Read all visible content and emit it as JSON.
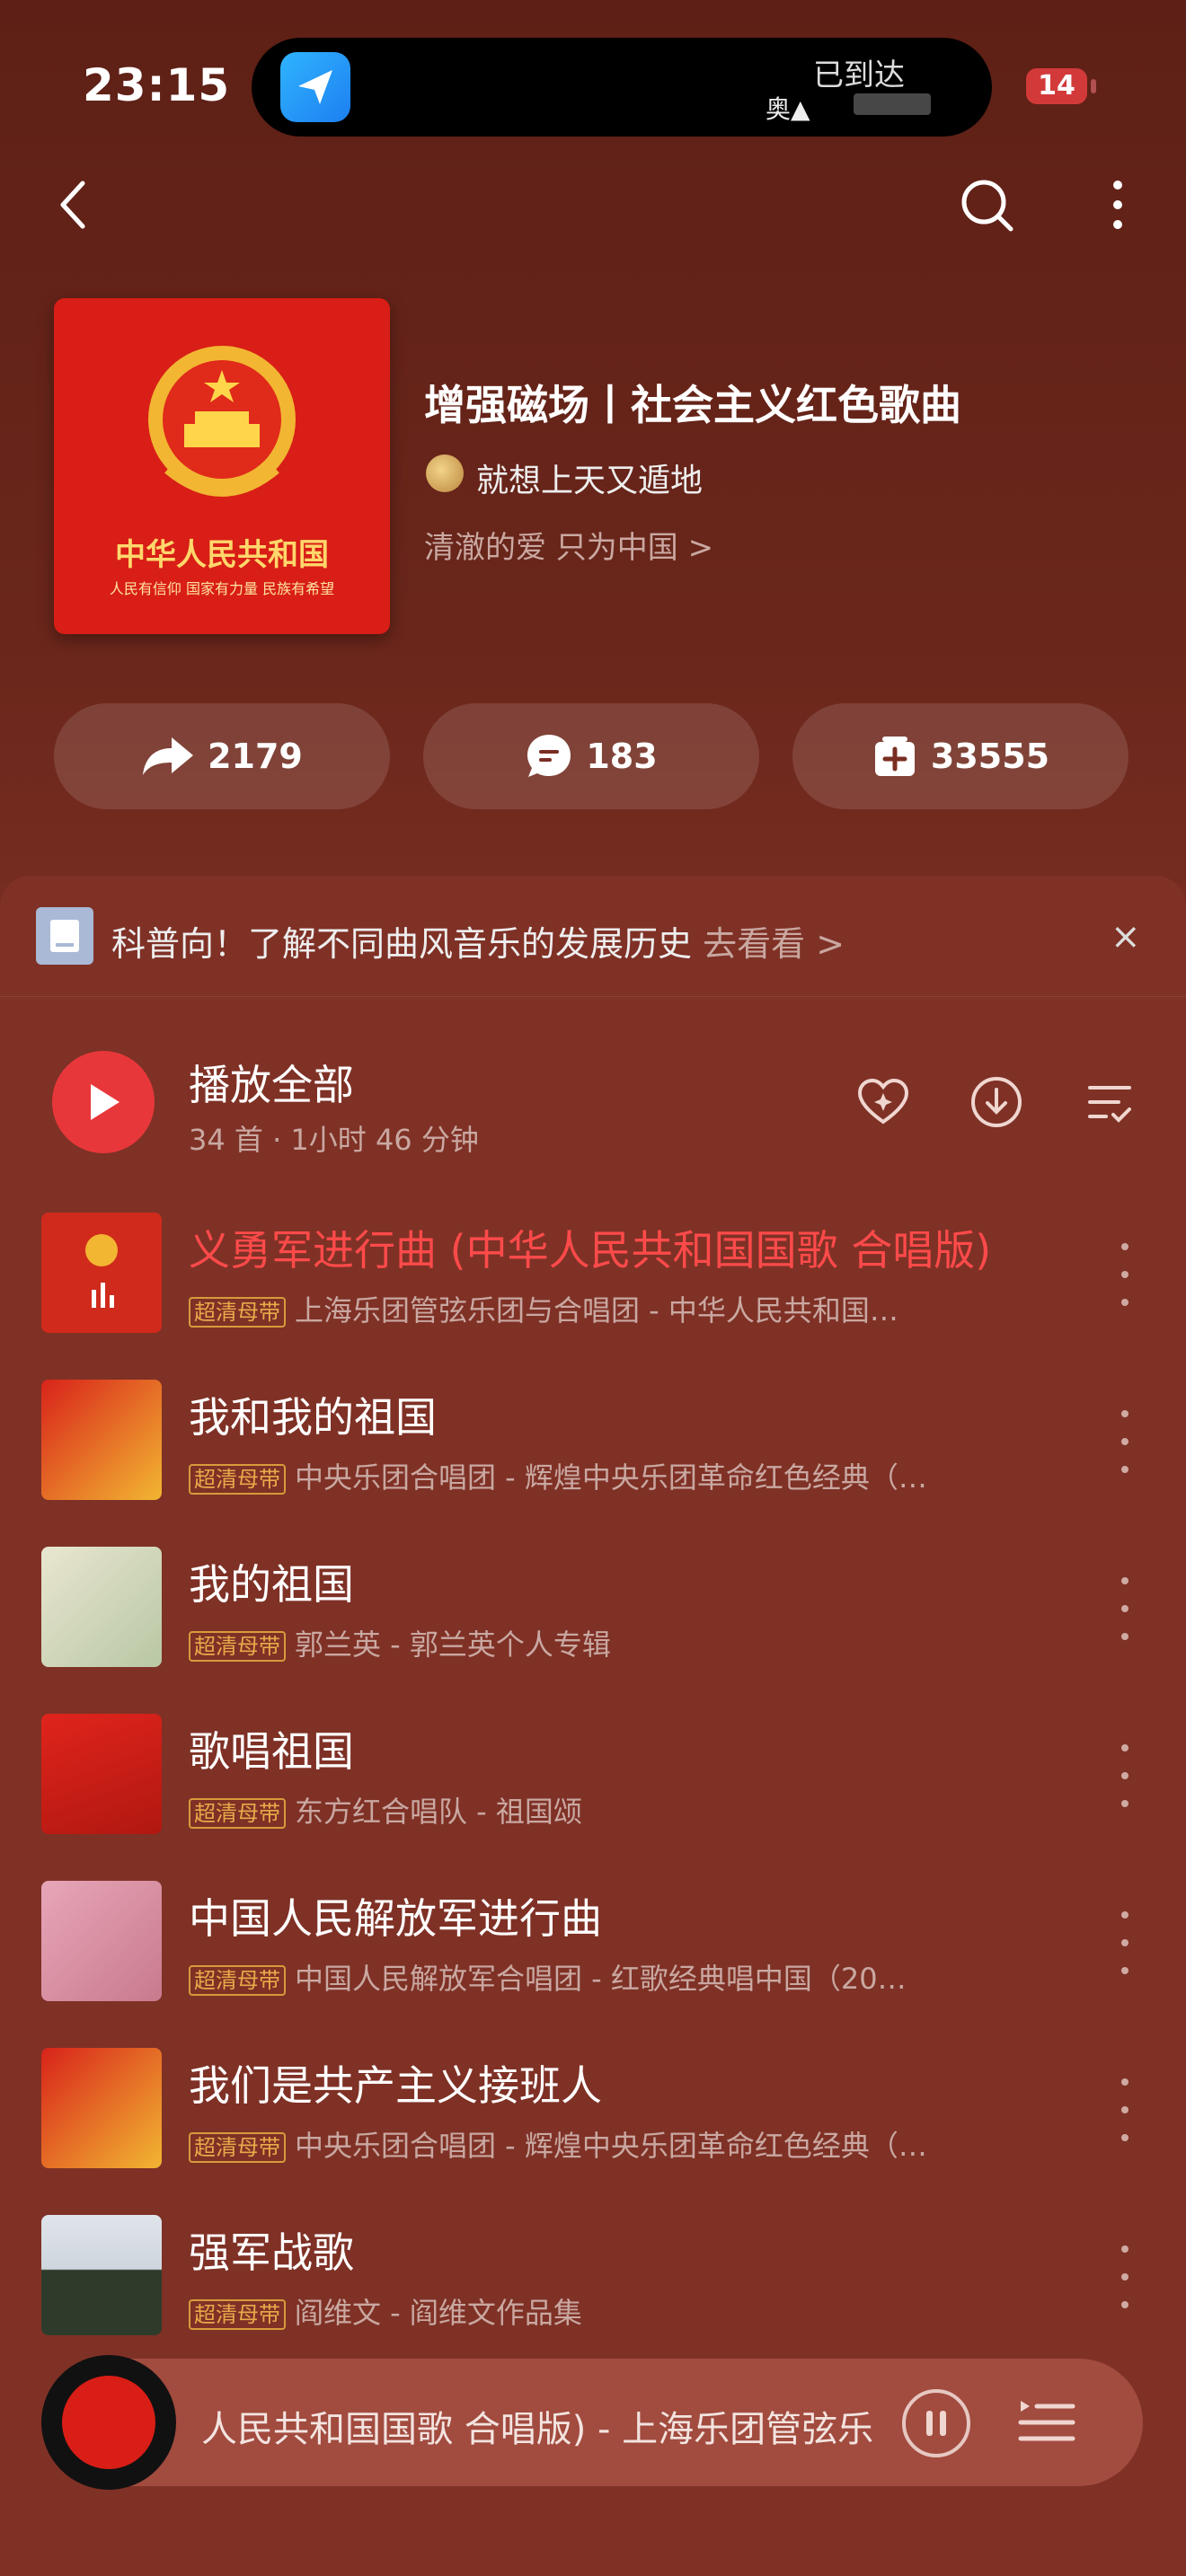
{
  "status_bar": {
    "time": "23:15",
    "island_text": "已到达",
    "island_glyph": "奥▲",
    "battery": "14"
  },
  "header": {
    "cover_title": "中华人民共和国",
    "cover_subtitle": "人民有信仰 国家有力量 民族有希望",
    "title": "增强磁场丨社会主义红色歌曲",
    "creator": "就想上天又遁地",
    "tagline": "清澈的爱 只为中国 >"
  },
  "actions": {
    "share": "2179",
    "comment": "183",
    "collect": "33555"
  },
  "tip": {
    "text": "科普向！了解不同曲风音乐的发展历史",
    "link": "去看看 >",
    "close": "×"
  },
  "playall": {
    "label": "播放全部",
    "meta": "34 首 · 1小时 46 分钟"
  },
  "badge_label": "超清母带",
  "songs": [
    {
      "title": "义勇军进行曲 (中华人民共和国国歌 合唱版)",
      "sub": "上海乐团管弦乐团与合唱团 - 中华人民共和国…",
      "active": true
    },
    {
      "title": "我和我的祖国",
      "sub": "中央乐团合唱团 - 辉煌中央乐团革命红色经典（…"
    },
    {
      "title": "我的祖国",
      "sub": "郭兰英 - 郭兰英个人专辑"
    },
    {
      "title": "歌唱祖国",
      "sub": "东方红合唱队 - 祖国颂"
    },
    {
      "title": "中国人民解放军进行曲",
      "sub": "中国人民解放军合唱团 - 红歌经典唱中国（20…"
    },
    {
      "title": "我们是共产主义接班人",
      "sub": "中央乐团合唱团 - 辉煌中央乐团革命红色经典（…"
    },
    {
      "title": "强军战歌",
      "sub": "阎维文 - 阎维文作品集"
    }
  ],
  "mini_player": {
    "text": "人民共和国国歌 合唱版) - 上海乐团管弦乐"
  },
  "colors": {
    "accent": "#e8373a",
    "badge": "#e9a94a"
  }
}
